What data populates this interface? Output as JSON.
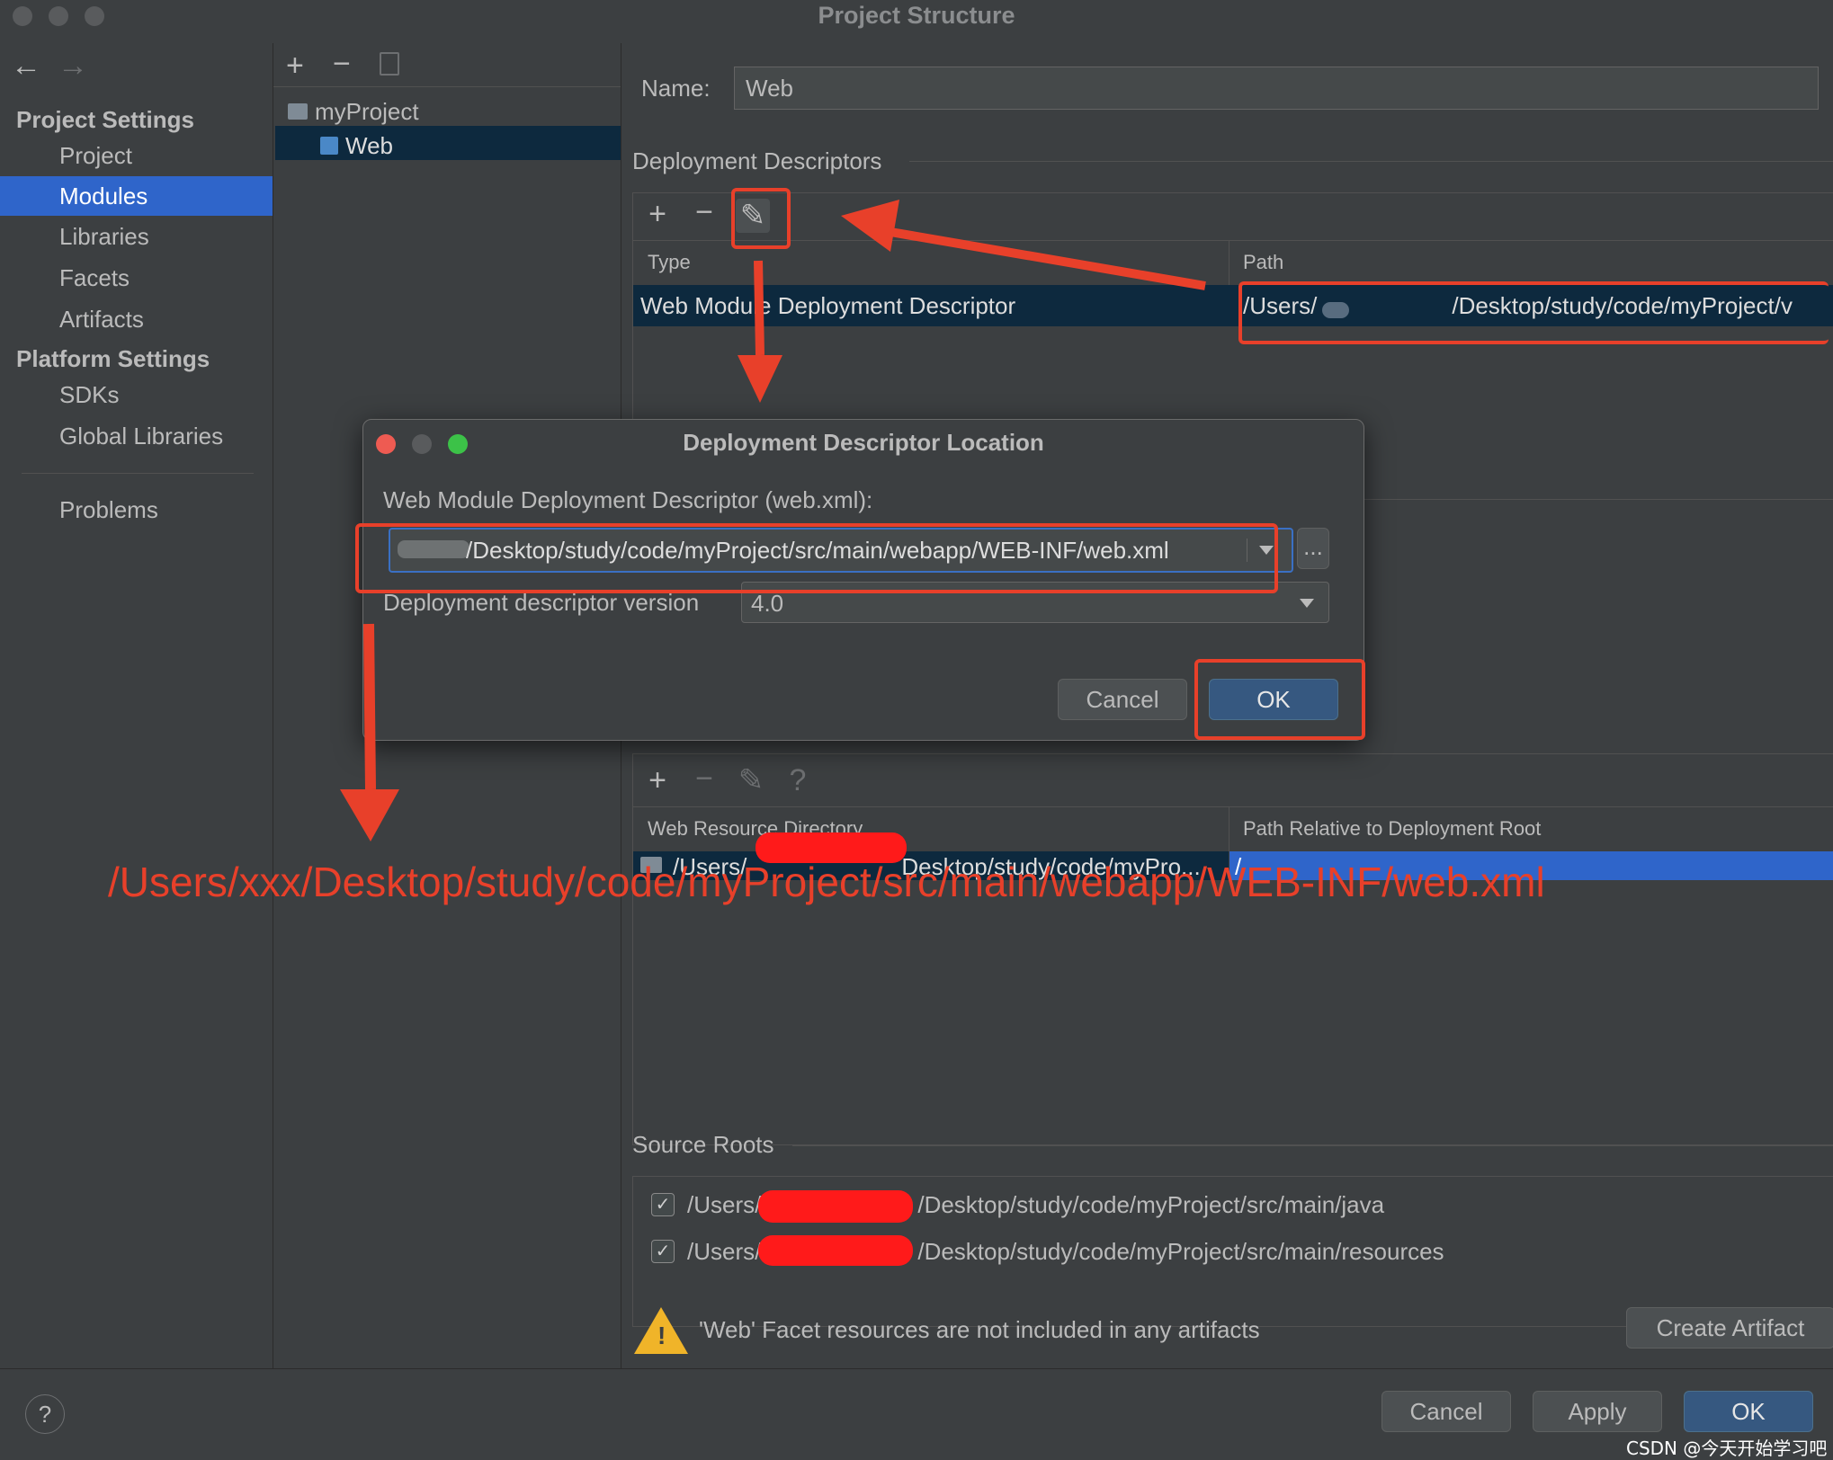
{
  "window": {
    "title": "Project Structure"
  },
  "nav": {
    "back_icon": "arrow-left-icon",
    "forward_icon": "arrow-right-icon",
    "project_settings_header": "Project Settings",
    "project_items": [
      "Project",
      "Modules",
      "Libraries",
      "Facets",
      "Artifacts"
    ],
    "platform_settings_header": "Platform Settings",
    "platform_items": [
      "SDKs",
      "Global Libraries"
    ],
    "problems": "Problems",
    "selected": "Modules"
  },
  "tree": {
    "items": [
      {
        "label": "myProject",
        "icon": "module-folder-icon"
      },
      {
        "label": "Web",
        "icon": "web-facet-icon"
      }
    ]
  },
  "main": {
    "name_label": "Name:",
    "name_value": "Web",
    "deployment_descriptors_title": "Deployment Descriptors",
    "dd_columns": [
      "Type",
      "Path"
    ],
    "dd_row": {
      "type": "Web Module Deployment Descriptor",
      "path_prefix": "/Users/",
      "path_suffix": "/Desktop/study/code/myProject/v"
    },
    "resource_columns": [
      "Web Resource Directory",
      "Path Relative to Deployment Root"
    ],
    "resource_row": {
      "dir_prefix": "/Users/",
      "dir_suffix": "Desktop/study/code/myPro...",
      "rel_path": "/"
    },
    "source_roots_title": "Source Roots",
    "source_roots": [
      {
        "prefix": "/Users/",
        "suffix": "/Desktop/study/code/myProject/src/main/java",
        "checked": true
      },
      {
        "prefix": "/Users/",
        "suffix": "/Desktop/study/code/myProject/src/main/resources",
        "checked": true
      }
    ],
    "warning_text": "'Web' Facet resources are not included in any artifacts",
    "create_artifact_button": "Create Artifact"
  },
  "dialog": {
    "title": "Deployment Descriptor Location",
    "descriptor_label": "Web Module Deployment Descriptor (web.xml):",
    "descriptor_value": "/Desktop/study/code/myProject/src/main/webapp/WEB-INF/web.xml",
    "browse_button": "...",
    "version_label": "Deployment descriptor version",
    "version_value": "4.0",
    "cancel_button": "Cancel",
    "ok_button": "OK"
  },
  "annotation": {
    "text": "/Users/xxx/Desktop/study/code/myProject/src/main/webapp/WEB-INF/web.xml",
    "color": "#e8402a"
  },
  "footer": {
    "help_button": "?",
    "cancel_button": "Cancel",
    "apply_button": "Apply",
    "ok_button": "OK"
  },
  "watermark": "CSDN @今天开始学习吧",
  "colors": {
    "selection": "#2f65ca",
    "primary_button": "#365880",
    "annotation_red": "#e8402a"
  }
}
